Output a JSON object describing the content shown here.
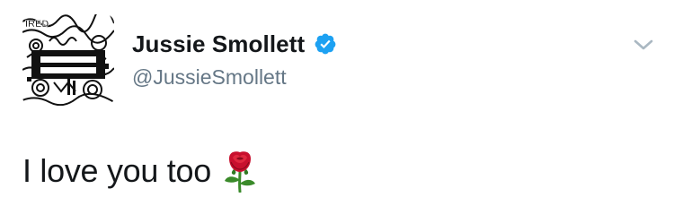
{
  "tweet": {
    "author": {
      "display_name": "Jussie Smollett",
      "handle": "@JussieSmollett",
      "verified": true,
      "avatar_lettering": "IRED"
    },
    "text": "I love you too",
    "emoji": "rose-emoji",
    "menu_icon": "chevron-down-icon"
  },
  "colors": {
    "name": "#14171a",
    "handle": "#657786",
    "verified_badge": "#1da1f2",
    "chevron": "#aab8c2",
    "rose_red": "#c8102e",
    "rose_leaf": "#3a8a2a"
  }
}
